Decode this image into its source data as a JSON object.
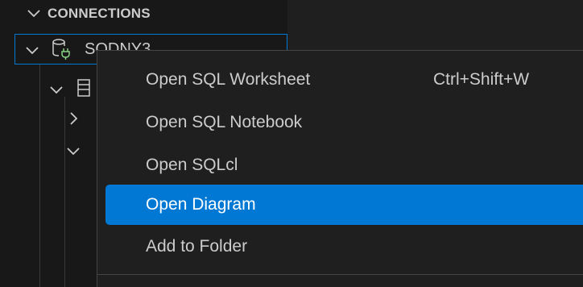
{
  "sidebar": {
    "section_title": "CONNECTIONS",
    "tree": {
      "connection": {
        "label": "SQDNY3"
      }
    }
  },
  "context_menu": {
    "items": [
      {
        "label": "Open SQL Worksheet",
        "shortcut": "Ctrl+Shift+W",
        "active": false
      },
      {
        "label": "Open SQL Notebook",
        "shortcut": "",
        "active": false
      },
      {
        "label": "Open SQLcl",
        "shortcut": "",
        "active": false
      },
      {
        "label": "Open Diagram",
        "shortcut": "",
        "active": true
      },
      {
        "label": "Add to Folder",
        "shortcut": "",
        "active": false
      }
    ]
  },
  "colors": {
    "accent": "#0078d4",
    "background": "#1f1f1f",
    "sidebar_background": "#181818",
    "text": "#cccccc",
    "connection_icon_plug": "#89d185"
  },
  "icons": {
    "section_toggle": "chevron-down-icon",
    "connection": "database-plug-icon",
    "schema": "schema-icon",
    "collapsed": "chevron-right-icon"
  }
}
